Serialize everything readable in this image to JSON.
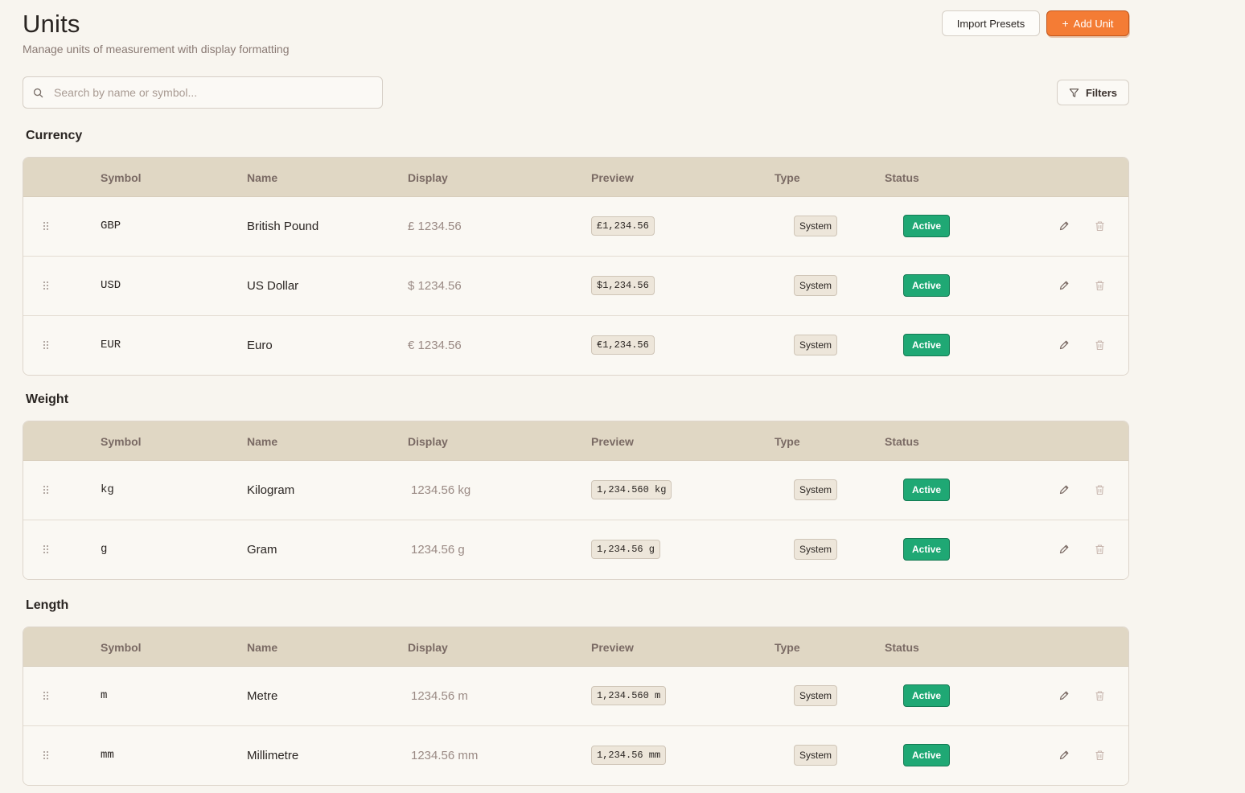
{
  "header": {
    "title": "Units",
    "subtitle": "Manage units of measurement with display formatting",
    "import_label": "Import Presets",
    "add_label": "Add Unit"
  },
  "search": {
    "placeholder": "Search by name or symbol..."
  },
  "filters_label": "Filters",
  "columns": {
    "symbol": "Symbol",
    "name": "Name",
    "display": "Display",
    "preview": "Preview",
    "type": "Type",
    "status": "Status"
  },
  "sections": [
    {
      "title": "Currency",
      "rows": [
        {
          "symbol": "GBP",
          "name": "British Pound",
          "display": "£ 1234.56",
          "preview": "£1,234.56",
          "type": "System",
          "status": "Active"
        },
        {
          "symbol": "USD",
          "name": "US Dollar",
          "display": "$ 1234.56",
          "preview": "$1,234.56",
          "type": "System",
          "status": "Active"
        },
        {
          "symbol": "EUR",
          "name": "Euro",
          "display": "€ 1234.56",
          "preview": "€1,234.56",
          "type": "System",
          "status": "Active"
        }
      ]
    },
    {
      "title": "Weight",
      "rows": [
        {
          "symbol": "kg",
          "name": "Kilogram",
          "display": "1234.56 kg",
          "preview": "1,234.560 kg",
          "type": "System",
          "status": "Active"
        },
        {
          "symbol": "g",
          "name": "Gram",
          "display": "1234.56 g",
          "preview": "1,234.56 g",
          "type": "System",
          "status": "Active"
        }
      ]
    },
    {
      "title": "Length",
      "rows": [
        {
          "symbol": "m",
          "name": "Metre",
          "display": "1234.56 m",
          "preview": "1,234.560 m",
          "type": "System",
          "status": "Active"
        },
        {
          "symbol": "mm",
          "name": "Millimetre",
          "display": "1234.56 mm",
          "preview": "1,234.56 mm",
          "type": "System",
          "status": "Active"
        }
      ]
    }
  ],
  "colors": {
    "accent": "#f47c35",
    "active_badge": "#1fa874",
    "header_bg": "#e0d7c4",
    "page_bg": "#f8f5ef"
  },
  "icons": {
    "search": "search-icon",
    "add": "plus-icon",
    "filters": "filter-icon",
    "drag": "drag-handle-icon",
    "edit": "pencil-icon",
    "delete": "trash-icon"
  }
}
